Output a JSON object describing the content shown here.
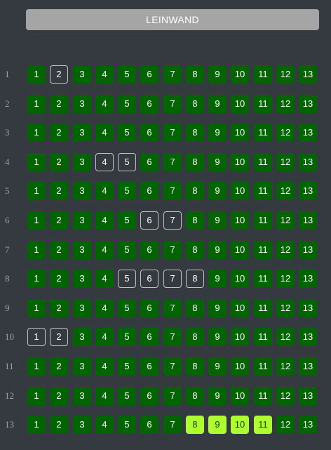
{
  "screen": {
    "label": "LEINWAND"
  },
  "colors": {
    "background": "#353a40",
    "screen": "#a5a5a5",
    "available": "#006400",
    "selected": "#adff2f",
    "occupied_border": "#c4c4c4"
  },
  "hall": {
    "seats_per_row": 13,
    "rows": [
      {
        "label": "1",
        "occupied": [
          2
        ],
        "selected": []
      },
      {
        "label": "2",
        "occupied": [],
        "selected": []
      },
      {
        "label": "3",
        "occupied": [],
        "selected": []
      },
      {
        "label": "4",
        "occupied": [
          4,
          5
        ],
        "selected": []
      },
      {
        "label": "5",
        "occupied": [],
        "selected": []
      },
      {
        "label": "6",
        "occupied": [
          6,
          7
        ],
        "selected": []
      },
      {
        "label": "7",
        "occupied": [],
        "selected": []
      },
      {
        "label": "8",
        "occupied": [
          5,
          6,
          7,
          8
        ],
        "selected": []
      },
      {
        "label": "9",
        "occupied": [],
        "selected": []
      },
      {
        "label": "10",
        "occupied": [
          1,
          2
        ],
        "selected": []
      },
      {
        "label": "11",
        "occupied": [],
        "selected": []
      },
      {
        "label": "12",
        "occupied": [],
        "selected": []
      },
      {
        "label": "13",
        "occupied": [],
        "selected": [
          8,
          9,
          10,
          11
        ]
      }
    ]
  }
}
